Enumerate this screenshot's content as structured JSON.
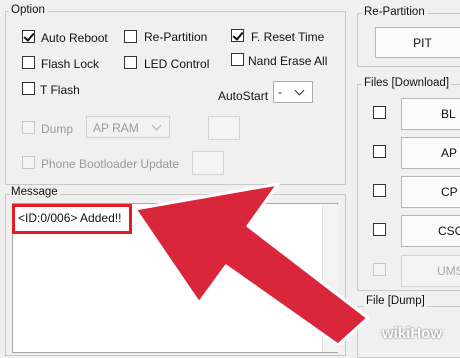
{
  "option": {
    "title": "Option",
    "auto_reboot": "Auto Reboot",
    "re_partition": "Re-Partition",
    "f_reset_time": "F. Reset Time",
    "flash_lock": "Flash Lock",
    "led_control": "LED Control",
    "nand_erase_all": "Nand Erase All",
    "t_flash": "T Flash",
    "autostart_label": "AutoStart",
    "autostart_value": "-",
    "dump": "Dump",
    "dump_target": "AP RAM",
    "phone_bootloader_update": "Phone Bootloader Update"
  },
  "message": {
    "title": "Message",
    "log_line": "<ID:0/006> Added!!"
  },
  "repartition": {
    "title": "Re-Partition",
    "pit_button": "PIT"
  },
  "files_download": {
    "title": "Files [Download]",
    "buttons": [
      "BL",
      "AP",
      "CP",
      "CSC",
      "UMS"
    ]
  },
  "file_dump": {
    "title": "File [Dump]"
  },
  "watermark": {
    "text": "wikiHow"
  },
  "colors": {
    "arrow_red": "#d9263b",
    "highlight_red": "#e31b23"
  }
}
